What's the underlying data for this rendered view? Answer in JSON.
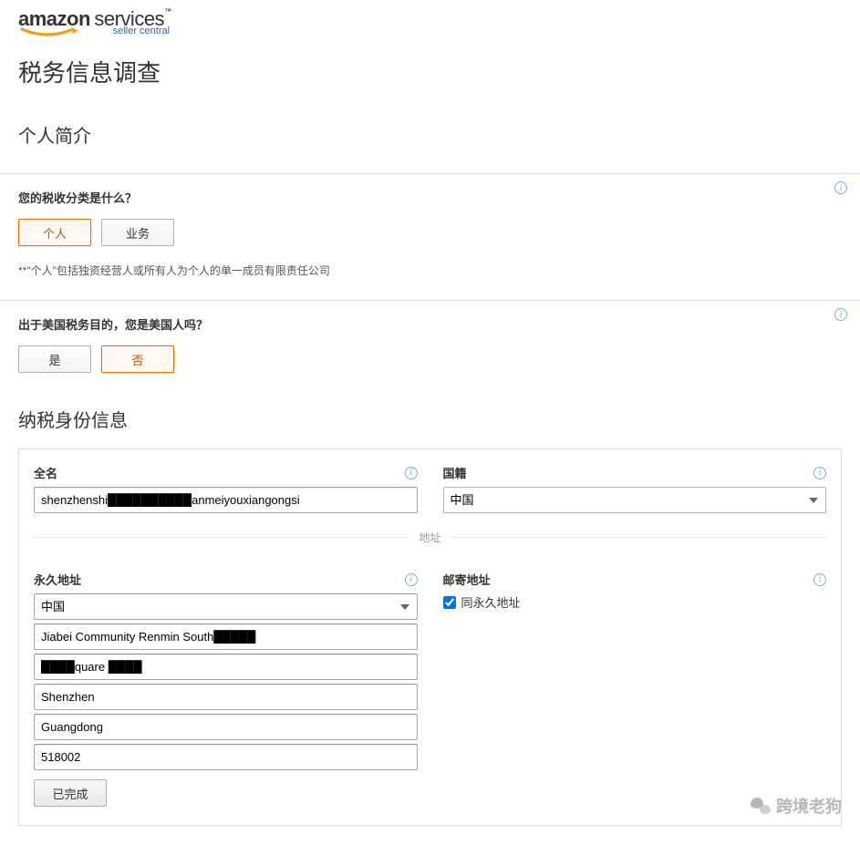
{
  "logo": {
    "amazon": "amazon",
    "services": "services",
    "seller_central": "seller central",
    "tm": "™"
  },
  "page_title": "税务信息调查",
  "profile_heading": "个人简介",
  "tax_class": {
    "question": "您的税收分类是什么？",
    "option_individual": "个人",
    "option_business": "业务",
    "hint": "**\"个人\"包括独资经营人或所有人为个人的单一成员有限责任公司"
  },
  "us_person": {
    "question": "出于美国税务目的，您是美国人吗？",
    "yes": "是",
    "no": "否"
  },
  "tax_identity_heading": "纳税身份信息",
  "form": {
    "full_name_label": "全名",
    "full_name_value": "shenzhenshi██████████anmeiyouxiangongsi",
    "nationality_label": "国籍",
    "nationality_value": "中国",
    "address_divider": "地址",
    "perm_addr_label": "永久地址",
    "mail_addr_label": "邮寄地址",
    "same_as_perm": "同永久地址",
    "country_value": "中国",
    "line1_value": "Jiabei Community Renmin South█████",
    "line2_value": "████quare ████",
    "city_value": "Shenzhen",
    "province_value": "Guangdong",
    "postal_value": "518002",
    "done_button": "已完成"
  },
  "watermark": "跨境老狗"
}
